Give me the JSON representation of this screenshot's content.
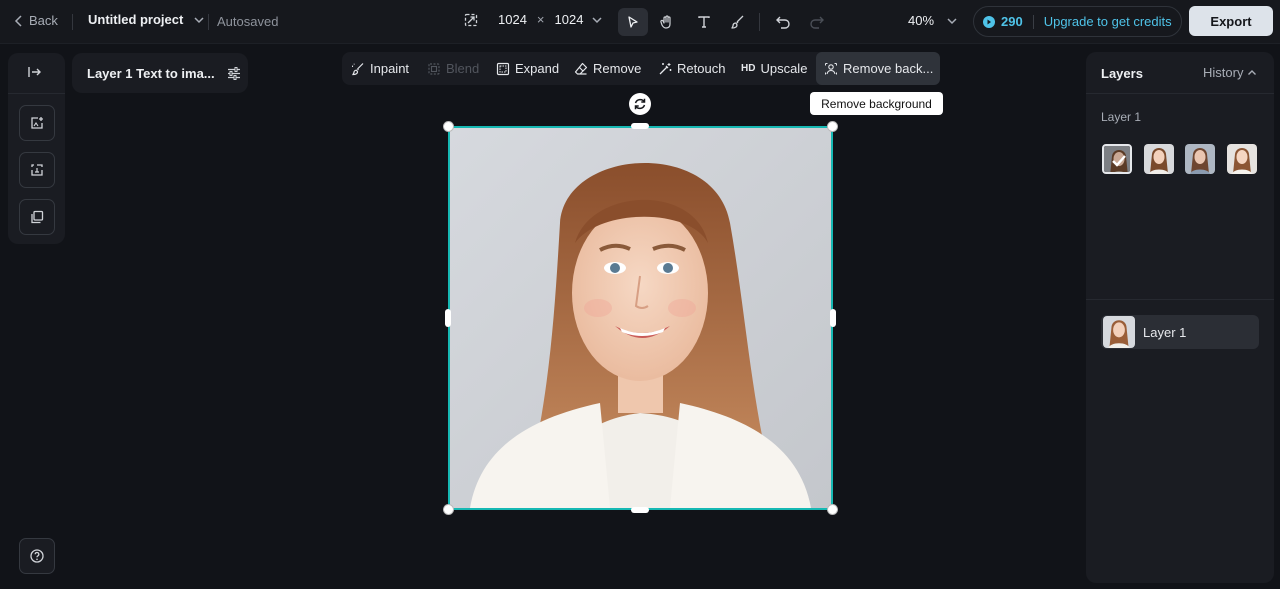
{
  "topbar": {
    "back_label": "Back",
    "project_name": "Untitled project",
    "save_status": "Autosaved",
    "canvas_width": "1024",
    "size_separator": "×",
    "canvas_height": "1024",
    "zoom": "40%",
    "credits": "290",
    "upgrade_label": "Upgrade to get credits",
    "export_label": "Export"
  },
  "tools": [
    "select-icon",
    "hand-icon",
    "text-icon",
    "brush-icon",
    "undo-icon",
    "redo-icon"
  ],
  "layer_tag": {
    "label": "Layer 1 Text to ima..."
  },
  "edit_toolbar": {
    "inpaint": "Inpaint",
    "blend": "Blend",
    "expand": "Expand",
    "remove": "Remove",
    "retouch": "Retouch",
    "upscale_badge": "HD",
    "upscale": "Upscale",
    "remove_background": "Remove back..."
  },
  "tooltip": "Remove background",
  "right_panel": {
    "layers_title": "Layers",
    "history_label": "History",
    "variations_title": "Layer 1",
    "layer_name": "Layer 1"
  },
  "colors": {
    "accent": "#16b8b3",
    "credits": "#4fc3e8",
    "background": "#111318",
    "panel": "#1a1c22"
  }
}
